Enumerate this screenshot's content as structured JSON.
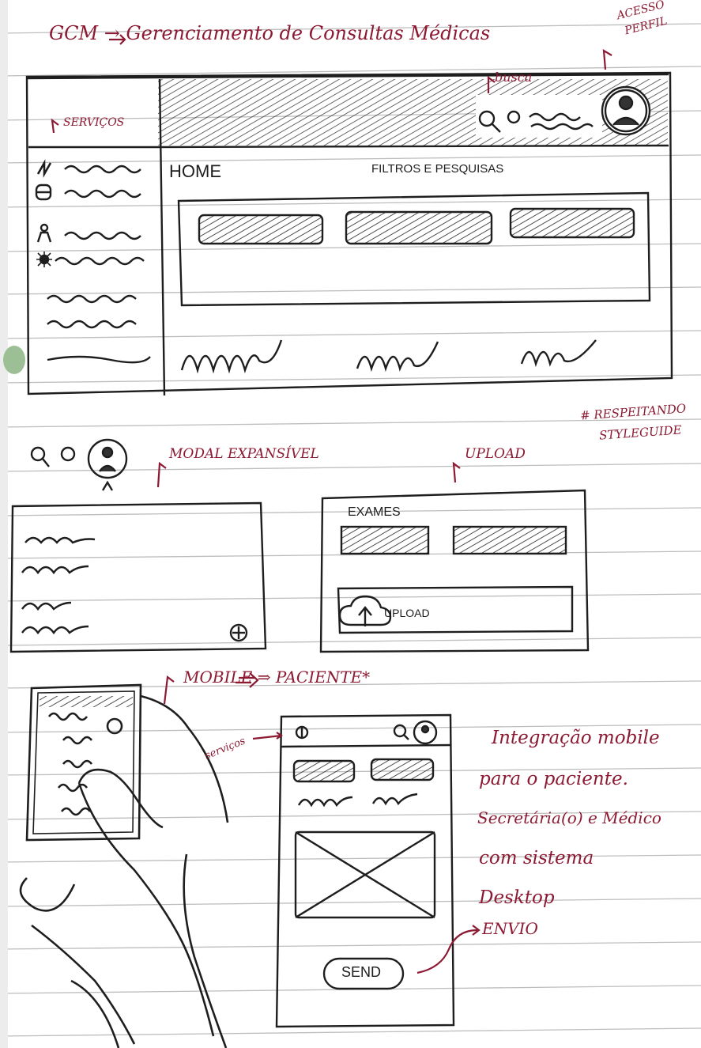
{
  "title": "GCM → Gerenciamento de Consultas Médicas",
  "annotations": {
    "acesso_perfil": [
      "ACESSO",
      "PERFIL"
    ],
    "busca": "busca",
    "servicos": "SERVIÇOS",
    "respeitando": [
      "# RESPEITANDO",
      "STYLEGUIDE"
    ],
    "modal_expansivel": "MODAL EXPANSÍVEL",
    "upload": "UPLOAD",
    "mobile_paciente": "MOBILE ⇒ PACIENTE*",
    "servicos_mobile": "serviços",
    "envio": "ENVIO",
    "note": [
      "Integração mobile",
      "para o paciente.",
      "Secretária(o) e Médico",
      "com sistema",
      "Desktop"
    ]
  },
  "desktop": {
    "home_label": "HOME",
    "filters_label": "FILTROS E PESQUISAS",
    "sidebar_icons": [
      "chart-icon",
      "database-icon",
      "user-icon",
      "gear-icon"
    ]
  },
  "upload_panel": {
    "title": "EXAMES",
    "upload_button": "UPLOAD"
  },
  "mobile": {
    "send_button": "SEND"
  },
  "colors": {
    "ink": "#1e1e1e",
    "annotation": "#8c1a33",
    "rule": "#bdbdbd"
  }
}
